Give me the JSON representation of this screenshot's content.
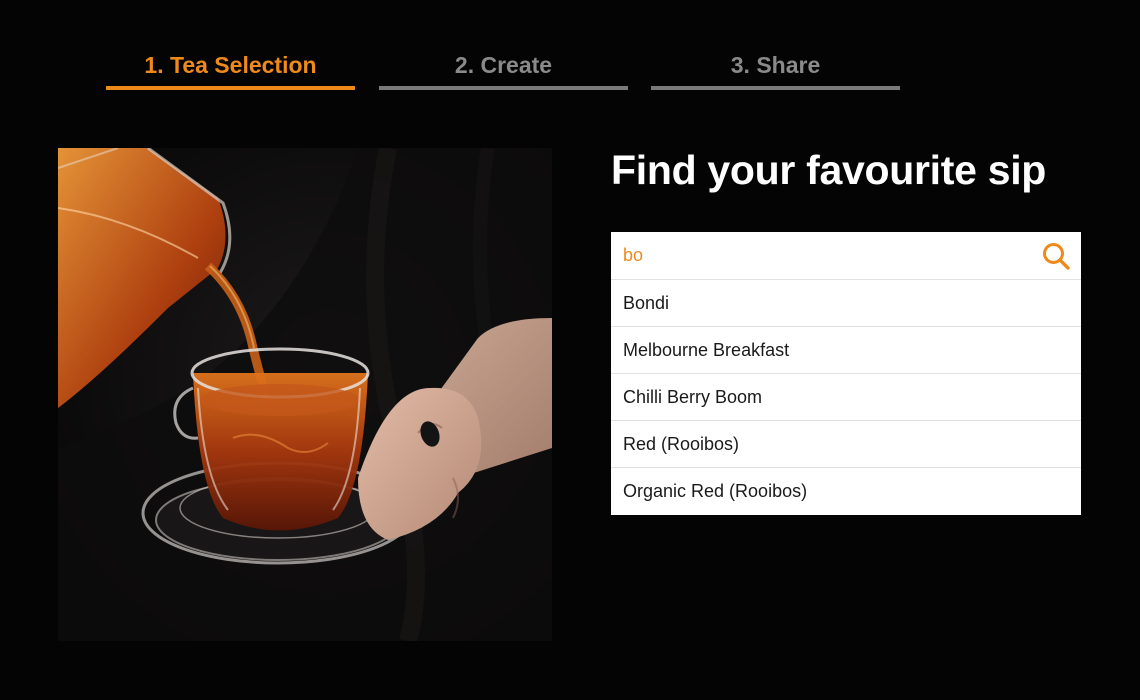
{
  "stepper": {
    "steps": [
      {
        "label": "1. Tea Selection",
        "state": "active"
      },
      {
        "label": "2. Create",
        "state": "inactive"
      },
      {
        "label": "3. Share",
        "state": "inactive"
      }
    ]
  },
  "hero_image": {
    "icon": "tea-pouring-photo"
  },
  "heading": "Find your favourite sip",
  "search": {
    "value": "bo",
    "icon": "search-icon",
    "suggestions": [
      "Bondi",
      "Melbourne Breakfast",
      "Chilli Berry Boom",
      "Red (Rooibos)",
      "Organic Red (Rooibos)"
    ]
  },
  "colors": {
    "accent": "#ee8a1c",
    "background": "#040404",
    "inactive_step": "#8a8a8a"
  }
}
